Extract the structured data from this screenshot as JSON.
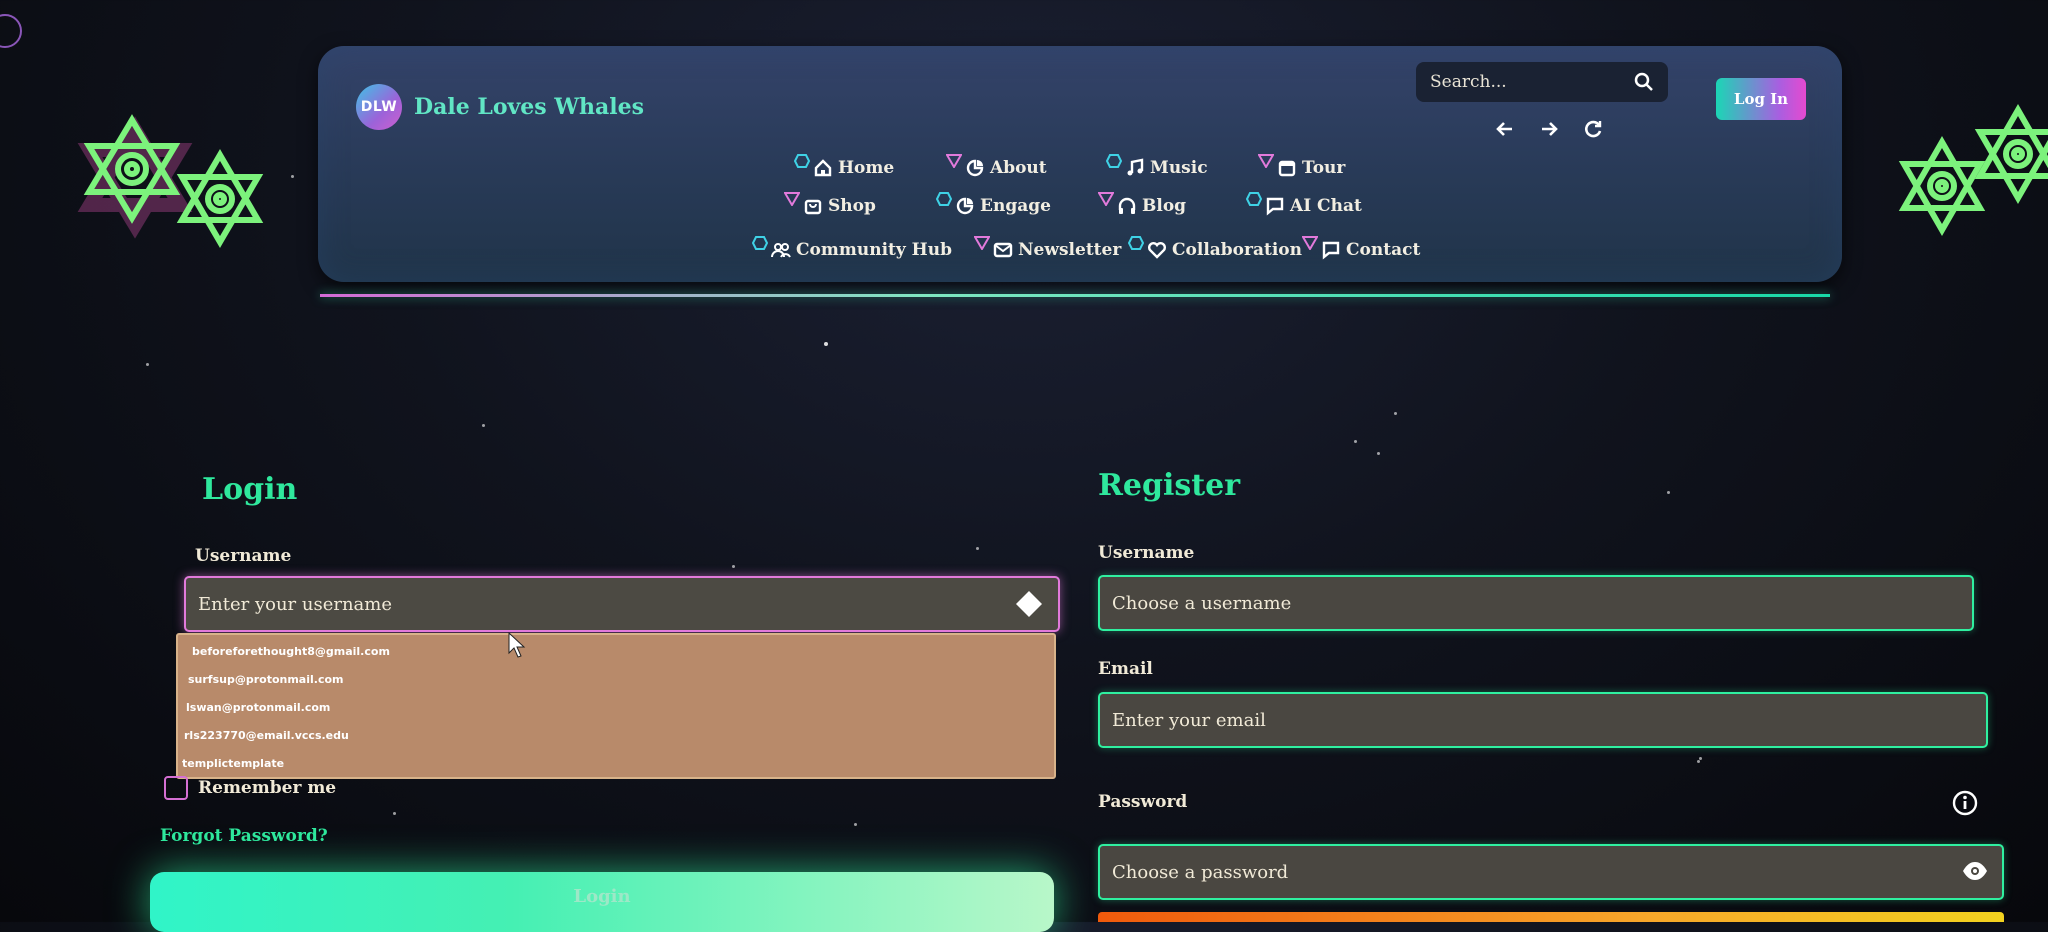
{
  "brand": {
    "badge": "DLW",
    "name": "Dale Loves Whales"
  },
  "search": {
    "placeholder": "Search..."
  },
  "header": {
    "login_label": "Log In"
  },
  "nav": [
    {
      "label": "Home",
      "icon": "home-icon"
    },
    {
      "label": "About",
      "icon": "about-icon"
    },
    {
      "label": "Music",
      "icon": "music-icon"
    },
    {
      "label": "Tour",
      "icon": "calendar-icon"
    },
    {
      "label": "Shop",
      "icon": "shopping-bag-icon"
    },
    {
      "label": "Engage",
      "icon": "engage-icon"
    },
    {
      "label": "Blog",
      "icon": "headphones-icon"
    },
    {
      "label": "AI Chat",
      "icon": "chat-icon"
    },
    {
      "label": "Community Hub",
      "icon": "users-icon"
    },
    {
      "label": "Newsletter",
      "icon": "envelope-icon"
    },
    {
      "label": "Collaboration",
      "icon": "heart-icon"
    },
    {
      "label": "Contact",
      "icon": "chat-icon"
    }
  ],
  "login": {
    "title": "Login",
    "username_label": "Username",
    "username_placeholder": "Enter your username",
    "autocomplete": [
      "beforeforethought8@gmail.com",
      "surfsup@protonmail.com",
      "lswan@protonmail.com",
      "rls223770@email.vccs.edu",
      "templictemplate"
    ],
    "remember_label": "Remember me",
    "forgot_label": "Forgot Password?",
    "submit_label": "Login"
  },
  "register": {
    "title": "Register",
    "username_label": "Username",
    "username_placeholder": "Choose a username",
    "email_label": "Email",
    "email_placeholder": "Enter your email",
    "password_label": "Password",
    "password_placeholder": "Choose a password"
  },
  "colors": {
    "accent_green": "#2fe89d",
    "accent_pink": "#e27adb",
    "header_bg": "#2a3b5a"
  }
}
